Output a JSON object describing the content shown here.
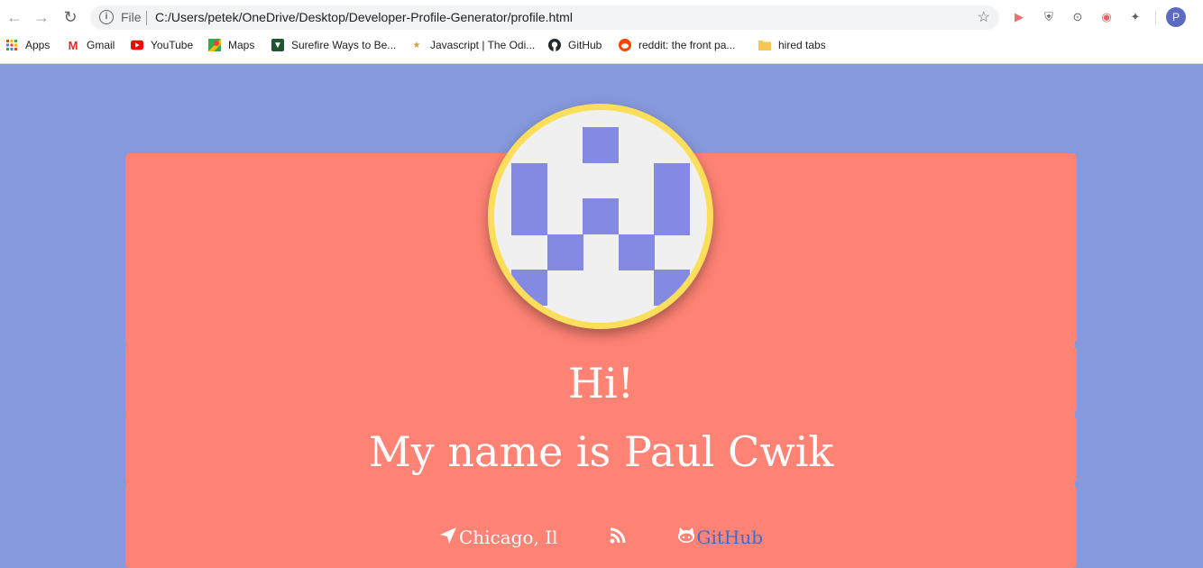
{
  "browser": {
    "scheme_label": "File",
    "url": "C:/Users/petek/OneDrive/Desktop/Developer-Profile-Generator/profile.html",
    "avatar_letter": "P"
  },
  "bookmarks": [
    {
      "label": "Apps",
      "icon": "apps-grid-icon"
    },
    {
      "label": "Gmail",
      "icon": "gmail-icon"
    },
    {
      "label": "YouTube",
      "icon": "youtube-icon"
    },
    {
      "label": "Maps",
      "icon": "maps-icon"
    },
    {
      "label": "Surefire Ways to Be...",
      "icon": "surefire-icon"
    },
    {
      "label": "Javascript | The Odi...",
      "icon": "odin-icon"
    },
    {
      "label": "GitHub",
      "icon": "github-icon"
    },
    {
      "label": "reddit: the front pa...",
      "icon": "reddit-icon"
    },
    {
      "label": "hired tabs",
      "icon": "folder-icon"
    }
  ],
  "profile": {
    "greeting": "Hi!",
    "name_line": "My name is Paul Cwik",
    "location": "Chicago, Il",
    "github_label": "GitHub"
  },
  "colors": {
    "page_bg": "#8799dd",
    "card_bg": "#ff8374",
    "ring": "#fbde5a",
    "identicon": "#8489e1",
    "link": "#3a6cd8"
  }
}
